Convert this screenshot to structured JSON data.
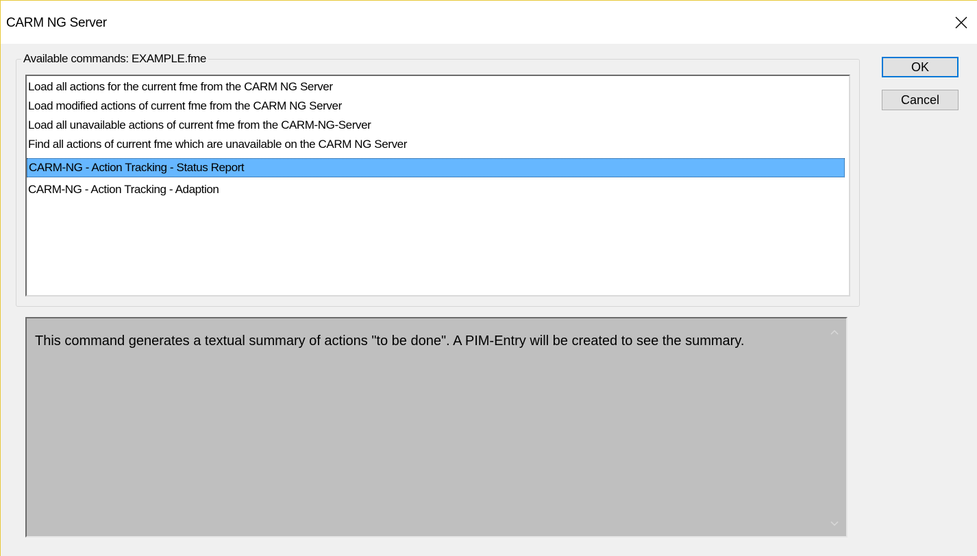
{
  "window": {
    "title": "CARM NG Server"
  },
  "commands": {
    "label": "Available commands: EXAMPLE.fme",
    "items": [
      "Load all actions for the current fme from the CARM NG Server",
      "Load modified actions of current fme from the CARM NG Server",
      "Load all unavailable actions of current fme from the CARM-NG-Server",
      "Find all actions of current fme which are unavailable on the CARM NG Server",
      "CARM-NG - Action Tracking - Status Report",
      "CARM-NG - Action Tracking - Adaption"
    ],
    "selected_index": 4
  },
  "buttons": {
    "ok": "OK",
    "cancel": "Cancel"
  },
  "description": {
    "text": "This command generates a textual summary of actions \"to be done\". A PIM-Entry will be created to see the summary."
  },
  "colors": {
    "selection": "#66b7ff",
    "description_bg": "#bfbfbf",
    "title_accent": "#e8c93a"
  },
  "icons": {
    "close": "close-icon",
    "scroll_up": "chevron-up-icon",
    "scroll_down": "chevron-down-icon"
  }
}
